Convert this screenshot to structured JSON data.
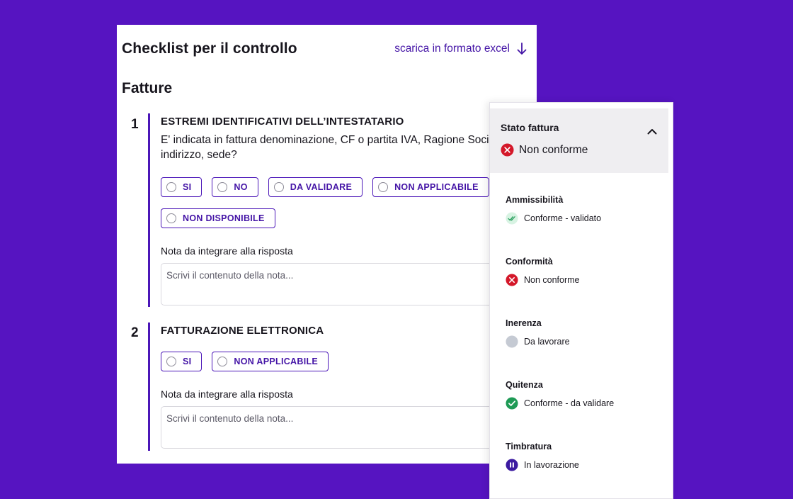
{
  "checklist": {
    "title": "Checklist per il controllo",
    "download_label": "scarica in formato excel",
    "section_title": "Fatture",
    "questions": [
      {
        "number": "1",
        "title": "ESTREMI IDENTIFICATIVI DELL’INTESTATARIO",
        "text_line1": "E' indicata in fattura denominazione, CF o partita IVA, Ragione Sociale,",
        "text_line2": "indirizzo, sede?",
        "options": [
          "SI",
          "NO",
          "DA VALIDARE",
          "NON APPLICABILE",
          "NON DISPONIBILE"
        ],
        "note_label": "Nota da integrare alla risposta",
        "note_placeholder": "Scrivi il contenuto della nota..."
      },
      {
        "number": "2",
        "title": "FATTURAZIONE ELETTRONICA",
        "options": [
          "SI",
          "NON APPLICABILE"
        ],
        "note_label": "Nota da integrare alla risposta",
        "note_placeholder": "Scrivi il contenuto della nota..."
      }
    ]
  },
  "panel": {
    "title": "Stato fattura",
    "overall_status": "Non conforme",
    "overall_icon": "error-x-icon",
    "items": [
      {
        "label": "Ammissibilità",
        "status": "Conforme - validato",
        "icon": "double-check-icon"
      },
      {
        "label": "Conformità",
        "status": "Non conforme",
        "icon": "error-x-icon"
      },
      {
        "label": "Inerenza",
        "status": "Da lavorare",
        "icon": "pending-dot-icon"
      },
      {
        "label": "Quitenza",
        "status": "Conforme - da validare",
        "icon": "check-circle-icon"
      },
      {
        "label": "Timbratura",
        "status": "In lavorazione",
        "icon": "pause-circle-icon"
      }
    ]
  },
  "colors": {
    "background": "#5614c1",
    "accent": "#4b16b8",
    "error": "#d4182a",
    "success": "#1e9a55",
    "success_light": "#d8f3e3",
    "neutral": "#c5cad3",
    "in_progress": "#3b1aa0"
  }
}
